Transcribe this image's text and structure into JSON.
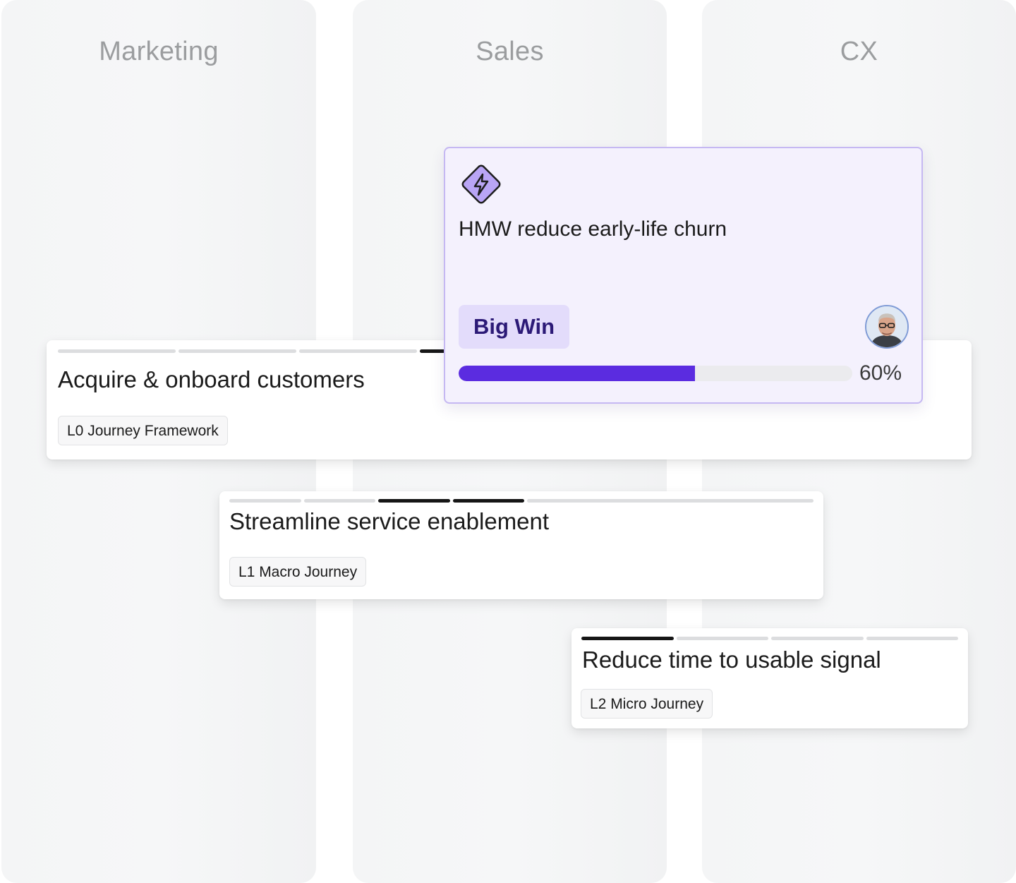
{
  "lanes": [
    {
      "title": "Marketing"
    },
    {
      "title": "Sales"
    },
    {
      "title": "CX"
    }
  ],
  "cards": {
    "l0": {
      "title": "Acquire & onboard customers",
      "tag": "L0 Journey Framework"
    },
    "l1": {
      "title": "Streamline service enablement",
      "tag": "L1 Macro Journey"
    },
    "l2": {
      "title": "Reduce time to usable signal",
      "tag": "L2 Micro Journey"
    }
  },
  "hmw": {
    "icon": "lightning-bolt-icon",
    "title": "HMW reduce early-life churn",
    "badge": "Big Win",
    "progress": 0.6,
    "progress_label": "60%",
    "accent_color": "#5b2ce0"
  }
}
